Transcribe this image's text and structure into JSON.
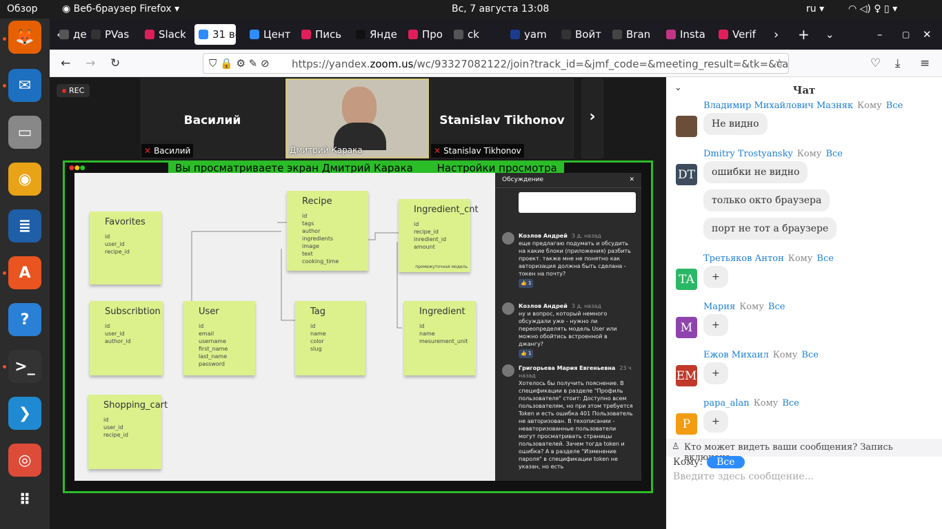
{
  "top_bar": {
    "overview": "Обзор",
    "app": "Веб-браузер Firefox",
    "clock": "Вс, 7 августа  13:08",
    "lang": "ru"
  },
  "dock": {
    "apps": [
      {
        "name": "firefox",
        "glyph": "🦊",
        "color": "#e66000"
      },
      {
        "name": "thunderbird",
        "glyph": "✉",
        "color": "#1d6fbf"
      },
      {
        "name": "files",
        "glyph": "▭",
        "color": "#888888"
      },
      {
        "name": "rhythmbox",
        "glyph": "◉",
        "color": "#e8a317"
      },
      {
        "name": "writer",
        "glyph": "≣",
        "color": "#1e5fa8"
      },
      {
        "name": "software",
        "glyph": "A",
        "color": "#e95420"
      },
      {
        "name": "help",
        "glyph": "?",
        "color": "#2a7fd6"
      },
      {
        "name": "terminal",
        "glyph": ">_",
        "color": "#333333"
      },
      {
        "name": "vscode",
        "glyph": "❯",
        "color": "#1f8ad2"
      },
      {
        "name": "chrome",
        "glyph": "◎",
        "color": "#dd4b39"
      },
      {
        "name": "apps-grid",
        "glyph": "⠿",
        "color": "#2c2c2c"
      }
    ]
  },
  "tabs": [
    "де",
    "PVas",
    "Slack",
    "31 во",
    "Цент",
    "Пись",
    "Янде",
    "Про",
    "ck",
    "yam",
    "Войт",
    "Bran",
    "Insta",
    "Verif"
  ],
  "tab_colors": [
    "#555555",
    "#333333",
    "#e01e5a",
    "#2d8cff",
    "#2d8cff",
    "#e01e5a",
    "#111111",
    "#e01e5a",
    "#555555",
    "#1a3c8c",
    "#333333",
    "#444444",
    "#c13584",
    "#e01e5a"
  ],
  "url": {
    "host": "https://yandex.",
    "domain": "zoom.us",
    "path": "/wc/93327082122/join?track_id=&jmf_code=&meeting_result=&tk=&cap=u"
  },
  "meeting": {
    "rec": "REC",
    "participants": [
      {
        "name": "Василий",
        "label": "Василий"
      },
      {
        "name": "",
        "label": "Дмитрий Карака"
      },
      {
        "name": "Stanislav Tikhonov",
        "label": "Stanislav Tikhonov"
      }
    ],
    "share_banner": "Вы просматриваете экран Дмитрий Карака",
    "view_settings": "Настройки просмотра",
    "board": {
      "notes": [
        {
          "title": "Favorites",
          "fields": [
            "id",
            "user_id",
            "recipe_id"
          ]
        },
        {
          "title": "Recipe",
          "fields": [
            "id",
            "tags",
            "author",
            "ingredients",
            "image",
            "text",
            "cooking_time"
          ]
        },
        {
          "title": "Ingredient_cnt",
          "fields": [
            "id",
            "recipe_id",
            "inredient_id",
            "amount"
          ],
          "note": "промежуточная модель"
        },
        {
          "title": "Subscribtion",
          "fields": [
            "id",
            "user_id",
            "author_id"
          ]
        },
        {
          "title": "User",
          "fields": [
            "id",
            "email",
            "username",
            "first_name",
            "last_name",
            "password"
          ]
        },
        {
          "title": "Tag",
          "fields": [
            "id",
            "name",
            "color",
            "slug"
          ]
        },
        {
          "title": "Ingredient",
          "fields": [
            "id",
            "name",
            "mesurement_unit"
          ]
        },
        {
          "title": "Shopping_cart",
          "fields": [
            "id",
            "user_id",
            "recipe_id"
          ]
        }
      ]
    },
    "discussion": {
      "title": "Обсуждение",
      "messages": [
        {
          "author": "Козлов Андрей",
          "time": "3 д. назад",
          "text": "еще предлагаю подумать и обсудить на какие блоки (приложения) разбить проект. также мне не понятно как авторизация должна быть сделана - токен на почту?",
          "react": "👍 1"
        },
        {
          "author": "Козлов Андрей",
          "time": "3 д. назад",
          "text": "ну и вопрос, который немного обсуждали уже - нужно ли переопределять модель User или можно обойтись встроенной в джангу?",
          "react": "👍 1"
        },
        {
          "author": "Григорьева Мария Евгеньевна",
          "time": "23 ч назад",
          "text": "Хотелось бы получить пояснение. В спецификации в разделе \"Профиль пользователя\" стоит: Доступно всем пользователям, но при этом требуется Token и есть ошибка 401 Пользователь не авторизован. В техописании - неавторизованные пользователи могут просматривать страницы пользователей. Зачем тогда token и ошибка? А в разделе \"Изменение пароля\" в спецификации token не указан, но есть",
          "react": ""
        }
      ]
    }
  },
  "chat": {
    "title": "Чат",
    "to_word": "Кому",
    "everyone": "Все",
    "messages": [
      {
        "sender": "Владимир Михайлович Мазняк",
        "avatar": "",
        "avatar_color": "#6b4e3a",
        "bubbles": [
          "Не видно"
        ]
      },
      {
        "sender": "Dmitry Trostyansky",
        "avatar": "DT",
        "avatar_color": "#3c4c5c",
        "bubbles": [
          "ошибки не видно",
          "только окто браузера",
          "порт не тот а браузере"
        ]
      },
      {
        "sender": "Третьяков Антон",
        "avatar": "TA",
        "avatar_color": "#2bb866",
        "bubbles": [
          "+"
        ]
      },
      {
        "sender": "Мария",
        "avatar": "M",
        "avatar_color": "#8e44ad",
        "bubbles": [
          "+"
        ]
      },
      {
        "sender": "Ежов Михаил",
        "avatar": "EM",
        "avatar_color": "#c0392b",
        "bubbles": [
          "+"
        ]
      },
      {
        "sender": "papa_alan",
        "avatar": "P",
        "avatar_color": "#f39c12",
        "bubbles": [
          "+"
        ]
      }
    ],
    "notice": "Кто может видеть ваши сообщения? Запись включена",
    "to_label": "Кому:",
    "to_value": "Все",
    "placeholder": "Введите здесь сообщение..."
  }
}
